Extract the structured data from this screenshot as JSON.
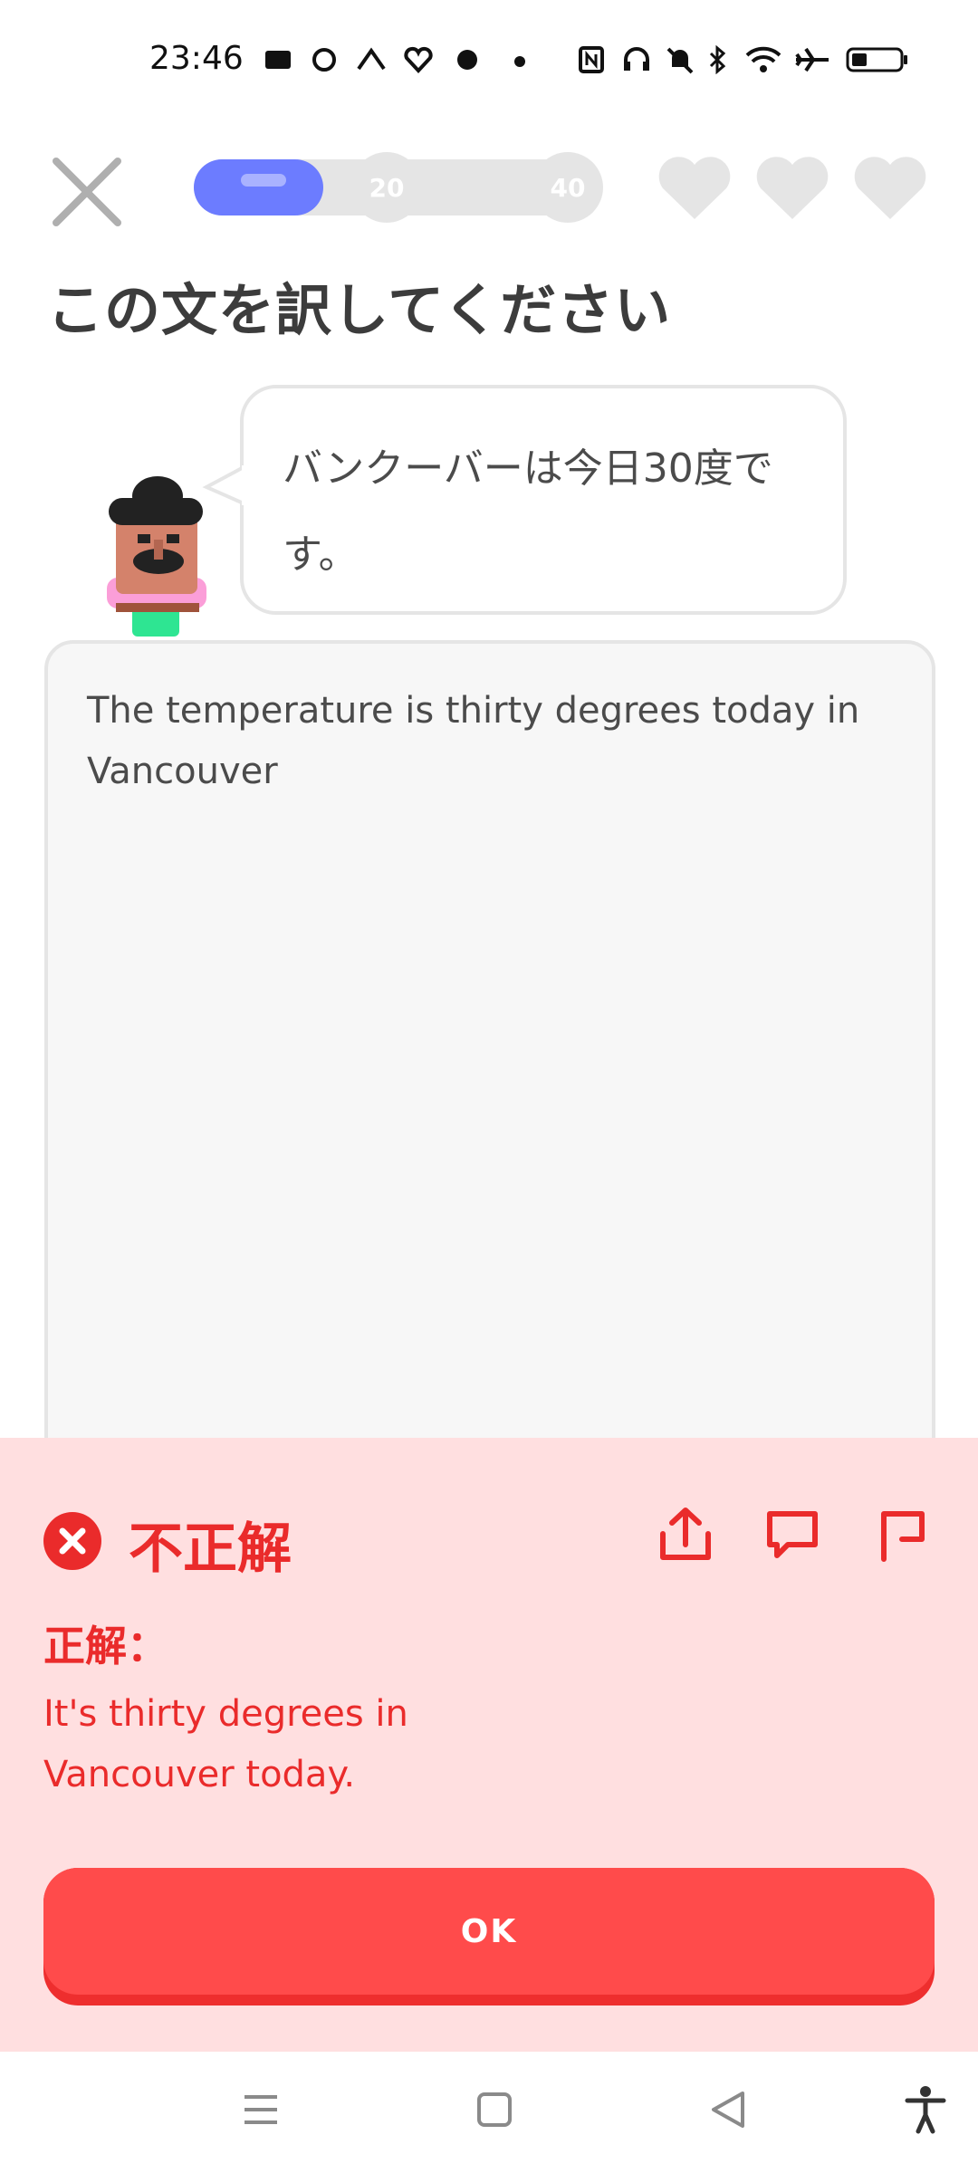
{
  "status_bar": {
    "time": "23:46",
    "icons": [
      "app-notification-icon",
      "sync-icon",
      "app-icon",
      "heart-app-icon",
      "app-icon",
      "dot-icon",
      "nfc-icon",
      "headphones-icon",
      "mute-icon",
      "bluetooth-icon",
      "wifi-icon",
      "airplane-icon",
      "battery-icon"
    ]
  },
  "header": {
    "close_icon": "close-icon",
    "progress": {
      "fraction": 0.33,
      "milestones": [
        "20",
        "40"
      ]
    },
    "hearts": {
      "count": 3,
      "color": "#e5e5e5"
    }
  },
  "prompt": {
    "title": "この文を訳してください",
    "sentence": "バンクーバーは今日30度です。"
  },
  "answer_input": {
    "value": "The temperature is thirty degrees today in Vancouver"
  },
  "feedback": {
    "status": "不正解",
    "correct_label": "正解：",
    "correct_answer": "It's thirty degrees in Vancouver today.",
    "actions": [
      "share-icon",
      "comment-icon",
      "report-flag-icon"
    ],
    "button_label": "OK",
    "colors": {
      "background": "#ffdfe0",
      "accent": "#ea2b2b",
      "button": "#ff4b4b"
    }
  },
  "nav_bar": {
    "icons": [
      "menu-icon",
      "home-square-icon",
      "back-triangle-icon",
      "accessibility-icon"
    ]
  },
  "colors": {
    "progress_fill": "#6c7cff",
    "track": "#e5e5e5"
  }
}
